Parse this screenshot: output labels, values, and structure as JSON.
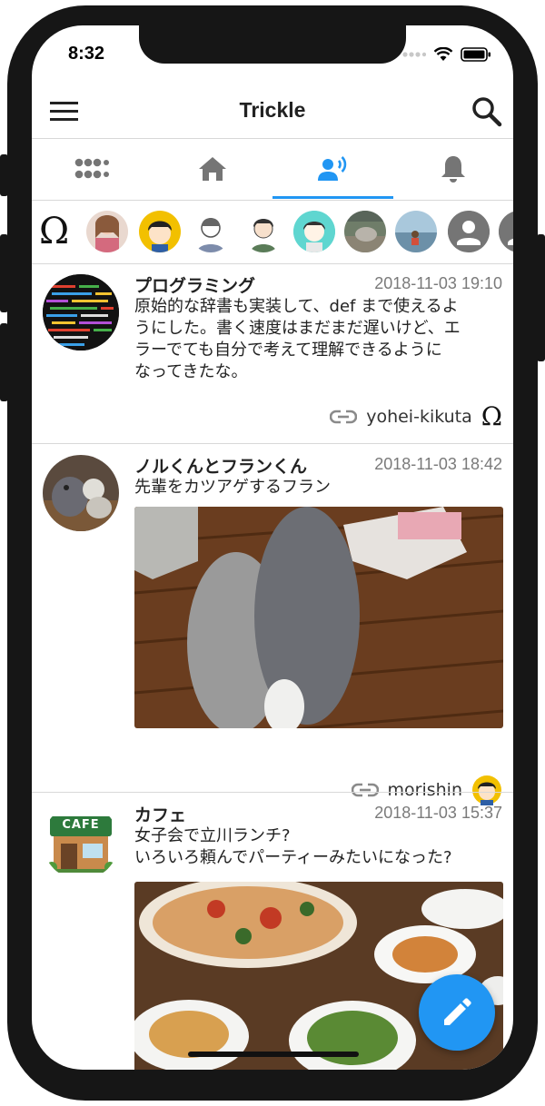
{
  "status_bar": {
    "time": "8:32"
  },
  "app_bar": {
    "title": "Trickle"
  },
  "avatar_strip": {
    "omega": "Ω"
  },
  "posts": [
    {
      "name": "プログラミング",
      "date": "2018-11-03 19:10",
      "text_lines": [
        "原始的な辞書も実装して、def まで使えるよ",
        "うにした。書く速度はまだまだ遅いけど、エ",
        "ラーでても自分で考えて理解できるように",
        "なってきたな。"
      ],
      "author": "yohei-kikuta",
      "author_badge": "Ω"
    },
    {
      "name": "ノルくんとフランくん",
      "date": "2018-11-03 18:42",
      "text_lines": [
        "先輩をカツアゲするフラン"
      ],
      "author": "morishin"
    },
    {
      "name": "カフェ",
      "date": "2018-11-03 15:37",
      "text_lines": [
        "女子会で立川ランチ?",
        "いろいろ頼んでパーティーみたいになった?"
      ],
      "cafe_sign": "CAFE"
    }
  ],
  "colors": {
    "accent": "#2196f3",
    "icon_gray": "#757575",
    "frame": "#161616"
  }
}
